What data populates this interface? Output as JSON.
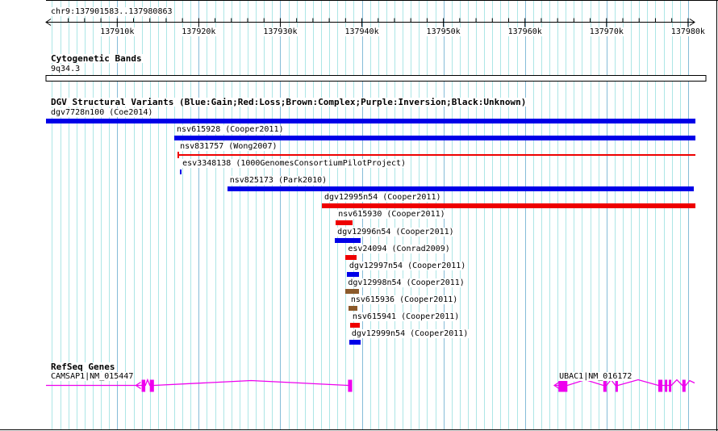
{
  "header": {
    "region_label": "chr9:137901583..137980863"
  },
  "sections": {
    "cytobands": {
      "title": "Cytogenetic Bands",
      "band_label": "9q34.3"
    },
    "dgv": {
      "title": "DGV Structural Variants (Blue:Gain;Red:Loss;Brown:Complex;Purple:Inversion;Black:Unknown)"
    },
    "refseq": {
      "title": "RefSeq Genes"
    }
  },
  "colors": {
    "blue": "#0000E8",
    "red": "#EE0000",
    "brown": "#8B5A2B",
    "magenta": "#EE00EE",
    "grid_light": "#ADE6E6",
    "grid_major": "#85BCD8",
    "axis_black": "#000000"
  },
  "chart_data": {
    "type": "genome-tracks",
    "region": {
      "chromosome": "chr9",
      "start": 137901583,
      "end": 137980863,
      "label": "chr9:137901583..137980863"
    },
    "x_axis": {
      "minor_tick_interval": 2000,
      "major_ticks": [
        {
          "value": 137910000,
          "label": "137910k"
        },
        {
          "value": 137920000,
          "label": "137920k"
        },
        {
          "value": 137930000,
          "label": "137930k"
        },
        {
          "value": 137940000,
          "label": "137940k"
        },
        {
          "value": 137950000,
          "label": "137950k"
        },
        {
          "value": 137960000,
          "label": "137960k"
        },
        {
          "value": 137970000,
          "label": "137970k"
        },
        {
          "value": 137980000,
          "label": "137980k"
        }
      ]
    },
    "cytogenetic_bands": [
      {
        "name": "9q34.3",
        "start": 137901583,
        "end": 137980863
      }
    ],
    "variant_legend": [
      {
        "color": "Blue",
        "meaning": "Gain"
      },
      {
        "color": "Red",
        "meaning": "Loss"
      },
      {
        "color": "Brown",
        "meaning": "Complex"
      },
      {
        "color": "Purple",
        "meaning": "Inversion"
      },
      {
        "color": "Black",
        "meaning": "Unknown"
      }
    ],
    "variants": [
      {
        "id": "dgv7728n100",
        "study": "Coe2014",
        "label": "dgv7728n100 (Coe2014)",
        "color": "blue",
        "type": "Gain",
        "glyph": "bar",
        "start": 137901583,
        "end": 137980863,
        "clip_left": true
      },
      {
        "id": "nsv615928",
        "study": "Cooper2011",
        "label": "nsv615928 (Cooper2011)",
        "color": "blue",
        "type": "Gain",
        "glyph": "bar",
        "start": 137917000,
        "end": 137980863
      },
      {
        "id": "nsv831757",
        "study": "Wong2007",
        "label": "nsv831757 (Wong2007)",
        "color": "red",
        "type": "Loss",
        "glyph": "thin-line",
        "start": 137917400,
        "end": 137980863
      },
      {
        "id": "esv3348138",
        "study": "1000GenomesConsortiumPilotProject",
        "label": "esv3348138 (1000GenomesConsortiumPilotProject)",
        "color": "blue",
        "type": "Gain",
        "glyph": "tick",
        "start": 137917700,
        "end": 137917900
      },
      {
        "id": "nsv825173",
        "study": "Park2010",
        "label": "nsv825173 (Park2010)",
        "color": "blue",
        "type": "Gain",
        "glyph": "bar",
        "start": 137923500,
        "end": 137980700
      },
      {
        "id": "dgv12995n54",
        "study": "Cooper2011",
        "label": "dgv12995n54 (Cooper2011)",
        "color": "red",
        "type": "Loss",
        "glyph": "bar",
        "start": 137935100,
        "end": 137980863
      },
      {
        "id": "nsv615930",
        "study": "Cooper2011",
        "label": "nsv615930 (Cooper2011)",
        "color": "red",
        "type": "Loss",
        "glyph": "bar",
        "start": 137936800,
        "end": 137938900
      },
      {
        "id": "dgv12996n54",
        "study": "Cooper2011",
        "label": "dgv12996n54 (Cooper2011)",
        "color": "blue",
        "type": "Gain",
        "glyph": "bar",
        "start": 137936700,
        "end": 137939850
      },
      {
        "id": "esv24094",
        "study": "Conrad2009",
        "label": "esv24094 (Conrad2009)",
        "color": "red",
        "type": "Loss",
        "glyph": "bar",
        "start": 137938000,
        "end": 137939350
      },
      {
        "id": "dgv12997n54",
        "study": "Cooper2011",
        "label": "dgv12997n54 (Cooper2011)",
        "color": "blue",
        "type": "Gain",
        "glyph": "bar",
        "start": 137938150,
        "end": 137939650
      },
      {
        "id": "dgv12998n54",
        "study": "Cooper2011",
        "label": "dgv12998n54 (Cooper2011)",
        "color": "brown",
        "type": "Complex",
        "glyph": "bar",
        "start": 137938000,
        "end": 137939650
      },
      {
        "id": "nsv615936",
        "study": "Cooper2011",
        "label": "nsv615936 (Cooper2011)",
        "color": "brown",
        "type": "Complex",
        "glyph": "bar",
        "start": 137938350,
        "end": 137939450
      },
      {
        "id": "nsv615941",
        "study": "Cooper2011",
        "label": "nsv615941 (Cooper2011)",
        "color": "red",
        "type": "Loss",
        "glyph": "bar",
        "start": 137938550,
        "end": 137939750
      },
      {
        "id": "dgv12999n54",
        "study": "Cooper2011",
        "label": "dgv12999n54 (Cooper2011)",
        "color": "blue",
        "type": "Gain",
        "glyph": "bar",
        "start": 137938450,
        "end": 137939850
      }
    ],
    "genes": [
      {
        "name": "CAMSAP1",
        "transcript": "NM_015447",
        "label": "CAMSAP1|NM_015447",
        "strand": "-",
        "start": 137901583,
        "end": 137938800,
        "clip_left": true,
        "arrows": [
          137912300
        ],
        "exons": [
          [
            137913000,
            137913450
          ],
          [
            137914000,
            137914500
          ],
          [
            137938300,
            137938800
          ]
        ]
      },
      {
        "name": "UBAC1",
        "transcript": "NM_016172",
        "label": "UBAC1|NM_016172",
        "strand": "-",
        "start": 137963600,
        "end": 137980800,
        "arrows": [
          137963600
        ],
        "exons": [
          [
            137964100,
            137965200
          ],
          [
            137969600,
            137970000
          ],
          [
            137971100,
            137971400
          ],
          [
            137976350,
            137976850
          ],
          [
            137977150,
            137977450
          ],
          [
            137977650,
            137977950
          ],
          [
            137979300,
            137979700
          ]
        ]
      }
    ]
  }
}
